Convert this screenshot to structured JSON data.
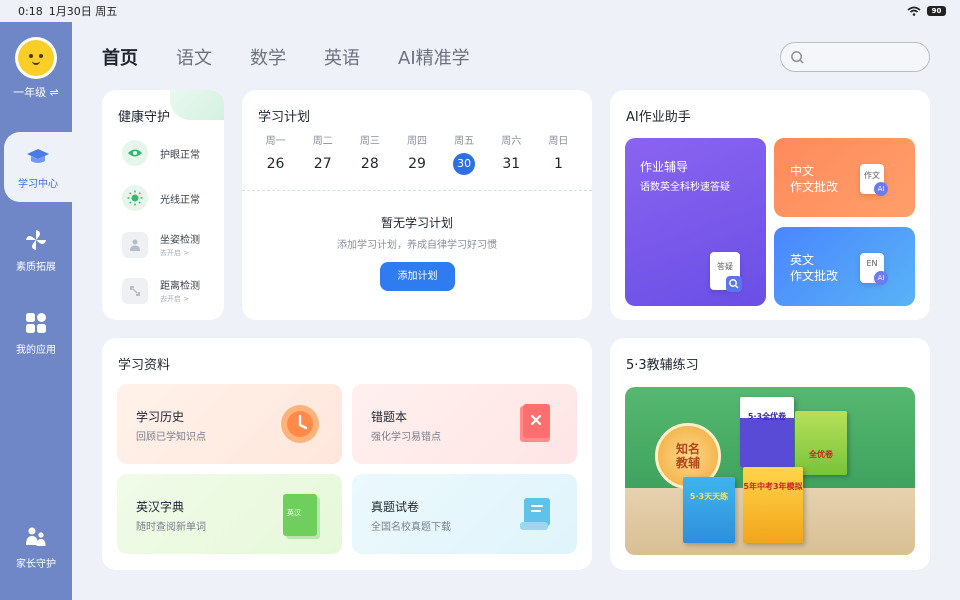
{
  "status": {
    "time": "0:18",
    "date": "1月30日 周五",
    "battery": "90"
  },
  "sidebar": {
    "grade": "一年级 ⇌",
    "items": [
      {
        "label": "学习中心"
      },
      {
        "label": "素质拓展"
      },
      {
        "label": "我的应用"
      },
      {
        "label": "家长守护"
      }
    ]
  },
  "tabs": [
    "首页",
    "语文",
    "数学",
    "英语",
    "AI精准学"
  ],
  "search": {
    "placeholder": ""
  },
  "health": {
    "title": "健康守护",
    "items": [
      {
        "label": "护眼正常",
        "sub": ""
      },
      {
        "label": "光线正常",
        "sub": ""
      },
      {
        "label": "坐姿检测",
        "sub": "去开启 >"
      },
      {
        "label": "距离检测",
        "sub": "去开启 >"
      }
    ]
  },
  "plan": {
    "title": "学习计划",
    "days": [
      {
        "name": "周一",
        "date": "26"
      },
      {
        "name": "周二",
        "date": "27"
      },
      {
        "name": "周三",
        "date": "28"
      },
      {
        "name": "周四",
        "date": "29"
      },
      {
        "name": "周五",
        "date": "30"
      },
      {
        "name": "周六",
        "date": "31"
      },
      {
        "name": "周日",
        "date": "1"
      }
    ],
    "empty_title": "暂无学习计划",
    "empty_sub": "添加学习计划，养成自律学习好习惯",
    "add_label": "添加计划"
  },
  "ai": {
    "title": "AI作业助手",
    "big": {
      "title": "作业辅导",
      "sub": "语数英全科秒速答疑",
      "paper": "答疑"
    },
    "zh": {
      "l1": "中文",
      "l2": "作文批改",
      "paper": "作文",
      "badge": "AI"
    },
    "en": {
      "l1": "英文",
      "l2": "作文批改",
      "paper": "EN",
      "badge": "AI"
    }
  },
  "materials": {
    "title": "学习资料",
    "items": [
      {
        "title": "学习历史",
        "sub": "回顾已学知识点"
      },
      {
        "title": "错题本",
        "sub": "强化学习易错点"
      },
      {
        "title": "英汉字典",
        "sub": "随时查阅新单词",
        "icon_text": "英汉"
      },
      {
        "title": "真题试卷",
        "sub": "全国名校真题下载"
      }
    ]
  },
  "p53": {
    "title": "5·3教辅练习",
    "badge_l1": "知名",
    "badge_l2": "教辅",
    "books": [
      "5·3全优卷",
      "5·3天天练",
      "5年中考3年模拟",
      "全优卷"
    ]
  },
  "colors": {
    "accent": "#2f6fe6",
    "sidebar": "#6f87c7",
    "bg": "#eef1f7"
  }
}
